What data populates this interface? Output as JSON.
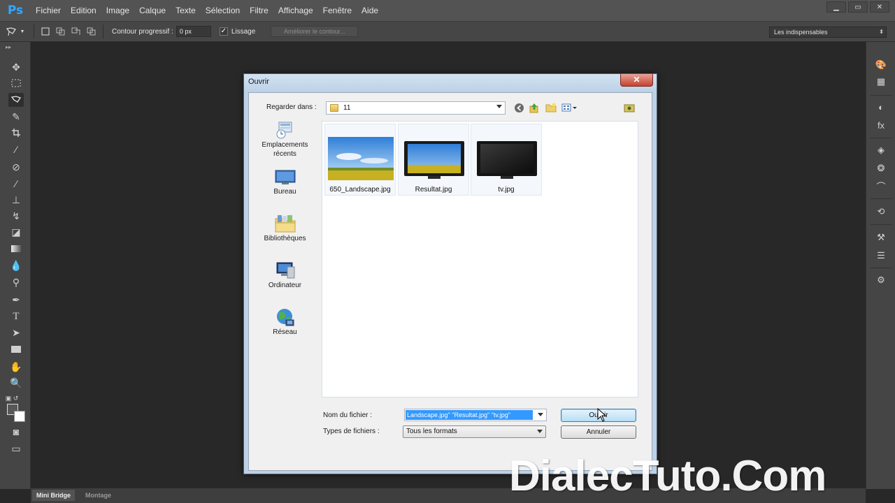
{
  "app": {
    "logo": "Ps"
  },
  "menu": [
    "Fichier",
    "Edition",
    "Image",
    "Calque",
    "Texte",
    "Sélection",
    "Filtre",
    "Affichage",
    "Fenêtre",
    "Aide"
  ],
  "window_controls": {
    "minimize": "▁",
    "maximize": "▭",
    "close": "✕"
  },
  "options_bar": {
    "feather_label": "Contour progressif :",
    "feather_value": "0 px",
    "smoothing_label": "Lissage",
    "smoothing_checked": true,
    "refine_edge_label": "Améliorer le contour...",
    "workspace_value": "Les indispensables"
  },
  "toolbar": {
    "tools": [
      "move",
      "marquee",
      "lasso",
      "quick-select",
      "crop",
      "eyedropper",
      "healing-brush",
      "brush",
      "clone-stamp",
      "history-brush",
      "eraser",
      "gradient",
      "blur",
      "dodge",
      "pen",
      "type",
      "path-select",
      "rectangle",
      "hand",
      "zoom"
    ],
    "active_tool": "lasso",
    "foreground_color": "#585858",
    "background_color": "#ffffff"
  },
  "right_panels": [
    "color",
    "swatches",
    "adjustments",
    "styles",
    "layers",
    "channels",
    "paths",
    "history",
    "actions",
    "properties",
    "character"
  ],
  "bottom_tabs": {
    "mini_bridge": "Mini Bridge",
    "montage": "Montage"
  },
  "dialog": {
    "title": "Ouvrir",
    "close_label": "✕",
    "look_in_label": "Regarder dans :",
    "look_in_value": "11",
    "places": [
      {
        "label": "Emplacements récents",
        "icon": "recent-places-icon"
      },
      {
        "label": "Bureau",
        "icon": "desktop-icon"
      },
      {
        "label": "Bibliothèques",
        "icon": "libraries-icon"
      },
      {
        "label": "Ordinateur",
        "icon": "computer-icon"
      },
      {
        "label": "Réseau",
        "icon": "network-icon"
      }
    ],
    "files": [
      {
        "name": "650_Landscape.jpg",
        "thumb": "landscape"
      },
      {
        "name": "Resultat.jpg",
        "thumb": "tv-landscape"
      },
      {
        "name": "tv.jpg",
        "thumb": "tv-black"
      }
    ],
    "file_name_label": "Nom du fichier :",
    "file_name_value": "Landscape.jpg\" \"Resultat.jpg\" \"tv.jpg\"",
    "file_type_label": "Types de fichiers :",
    "file_type_value": "Tous les formats",
    "open_button": "Ouvrir",
    "cancel_button": "Annuler"
  },
  "watermark": "DialecTuto.Com"
}
